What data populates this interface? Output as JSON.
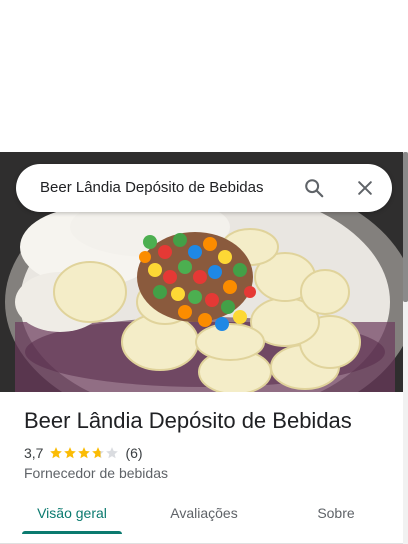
{
  "search": {
    "query": "Beer Lândia Depósito de Bebidas",
    "search_icon": "search-icon",
    "close_icon": "close-icon"
  },
  "hero": {
    "description_icon": "place-photo"
  },
  "place": {
    "name": "Beer Lândia Depósito de Bebidas",
    "rating": "3,7",
    "rating_value": 3.7,
    "review_count": "(6)",
    "category": "Fornecedor de bebidas"
  },
  "tabs": [
    {
      "label": "Visão geral",
      "active": true
    },
    {
      "label": "Avaliações",
      "active": false
    },
    {
      "label": "Sobre",
      "active": false
    }
  ],
  "colors": {
    "accent": "#0b7a6f",
    "star_filled": "#fbbc04",
    "star_empty": "#dadce0",
    "text_primary": "#202124",
    "text_secondary": "#5f6368"
  }
}
